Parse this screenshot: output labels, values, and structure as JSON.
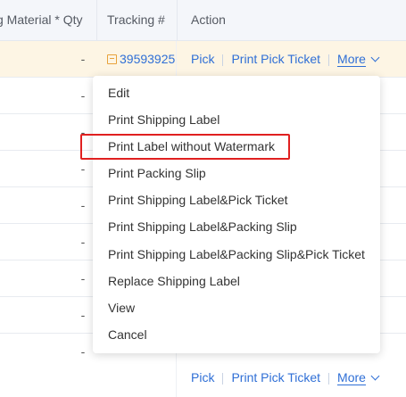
{
  "table": {
    "headers": {
      "qty": "g Material * Qty",
      "tracking": "Tracking #",
      "action": "Action"
    },
    "first_row": {
      "qty": "-",
      "tracking": "39593925",
      "pick": "Pick",
      "print_pick_ticket": "Print Pick Ticket",
      "more": "More"
    },
    "rows": [
      {
        "qty": "-"
      },
      {
        "qty": "-"
      },
      {
        "qty": "-"
      },
      {
        "qty": "-"
      },
      {
        "qty": "-"
      },
      {
        "qty": "-"
      },
      {
        "qty": "-"
      },
      {
        "qty": "-"
      }
    ],
    "last_row": {
      "pick": "Pick",
      "print_pick_ticket": "Print Pick Ticket",
      "more": "More"
    }
  },
  "menu": {
    "items": [
      "Edit",
      "Print Shipping Label",
      "Print Label without Watermark",
      "Print Packing Slip",
      "Print Shipping Label&Pick Ticket",
      "Print Shipping Label&Packing Slip",
      "Print Shipping Label&Packing Slip&Pick Ticket",
      "Replace Shipping Label",
      "View",
      "Cancel"
    ]
  },
  "colors": {
    "link": "#2f6fd6",
    "highlight_row": "#fdf5e4",
    "annotation_box": "#e02020",
    "header_bg": "#f4f6fa"
  }
}
